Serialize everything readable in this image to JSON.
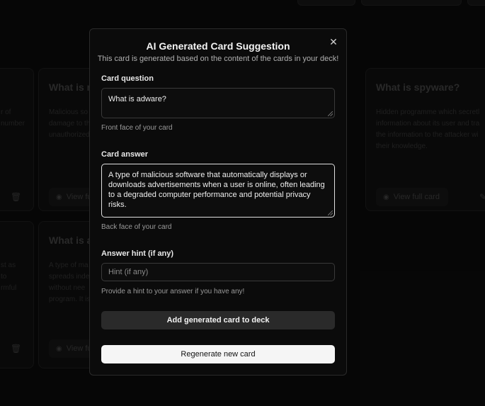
{
  "background_cards": [
    {
      "question": "",
      "answer": "r of\nnumber",
      "view_label": ""
    },
    {
      "question": "What is m",
      "answer": "Malicious so\ndamage to th\nunauthorized",
      "view_label": "View fu"
    },
    {
      "question": "What is spyware?",
      "answer": "Hidden programme which secretl\ninformation about its user and tra\nthe information to the attacker wi\ntheir knowledge.",
      "view_label": "View full card"
    },
    {
      "question": "",
      "answer": "st as\nto\nrmful",
      "view_label": ""
    },
    {
      "question": "What is a",
      "answer": "A type of ma\nspreads inde\nwithout nee\nprogram. It is",
      "view_label": "View fu"
    }
  ],
  "modal": {
    "title": "AI Generated Card Suggestion",
    "subtitle": "This card is generated based on the content of the cards in your deck!",
    "question_label": "Card question",
    "question_value": "What is adware?",
    "question_help": "Front face of your card",
    "answer_label": "Card answer",
    "answer_value": "A type of malicious software that automatically displays or downloads advertisements when a user is online, often leading to a degraded computer performance and potential privacy risks.",
    "answer_help": "Back face of your card",
    "hint_label": "Answer hint (if any)",
    "hint_placeholder": "Hint (if any)",
    "hint_value": "",
    "hint_help": "Provide a hint to your answer if you have any!",
    "add_button": "Add generated card to deck",
    "regen_button": "Regenerate new card",
    "close_icon": "close-icon"
  },
  "icons": {
    "eye": "eye-icon",
    "trash": "trash-icon",
    "edit": "edit-icon"
  }
}
